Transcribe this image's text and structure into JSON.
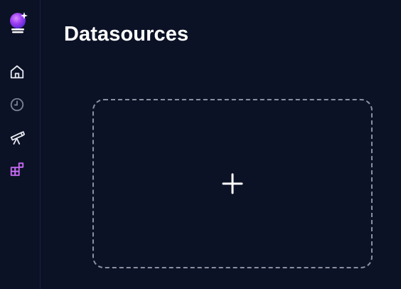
{
  "page": {
    "title": "Datasources"
  },
  "sidebar": {
    "items": [
      {
        "id": "home",
        "icon": "home-icon"
      },
      {
        "id": "history",
        "icon": "clock-icon"
      },
      {
        "id": "explore",
        "icon": "telescope-icon"
      },
      {
        "id": "datasources",
        "icon": "blocks-icon",
        "active": true
      }
    ]
  },
  "main": {
    "add_datasource": {
      "icon": "plus-icon"
    }
  },
  "colors": {
    "background": "#0c1226",
    "accent": "#c96cf5",
    "icon": "#e6e8ef",
    "icon_muted": "#7a8194",
    "dashed_border": "#8b90a0"
  }
}
